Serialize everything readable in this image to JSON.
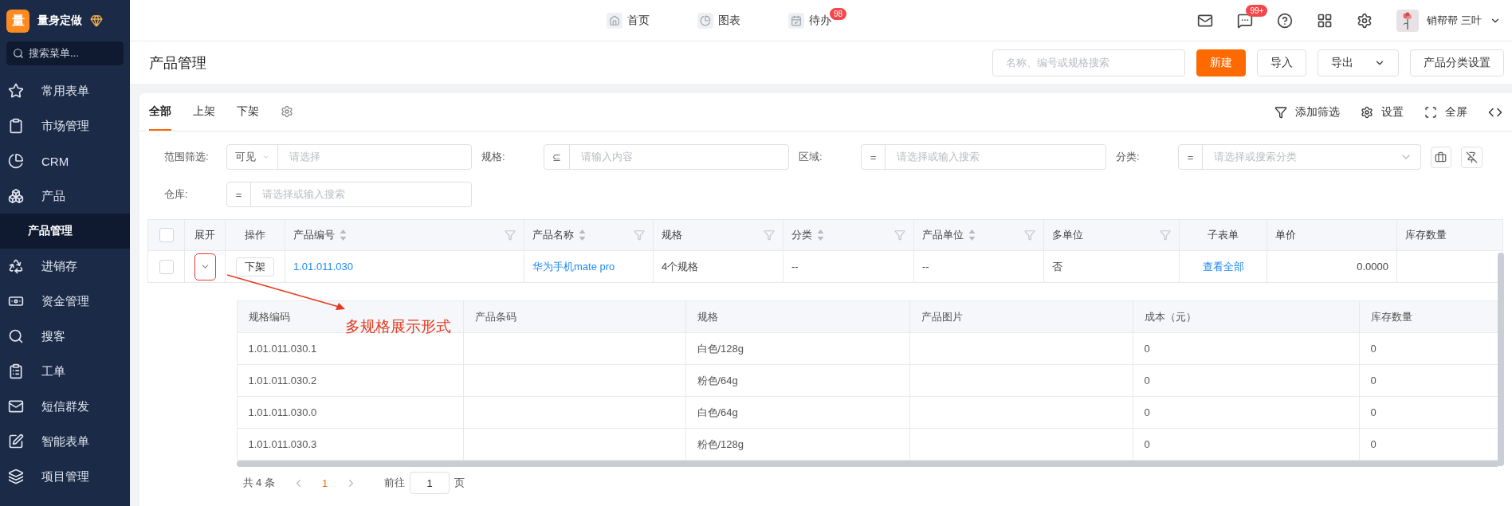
{
  "sidebar": {
    "brand": {
      "logo": "量",
      "name": "量身定做"
    },
    "search": {
      "placeholder": "搜索菜单..."
    },
    "items": [
      {
        "label": "常用表单",
        "selected": false
      },
      {
        "label": "市场管理",
        "selected": false
      },
      {
        "label": "CRM",
        "selected": false
      },
      {
        "label": "产品",
        "selected": false,
        "expanded": true,
        "children": [
          {
            "label": "产品管理",
            "selected": true
          }
        ]
      },
      {
        "label": "进销存",
        "selected": false
      },
      {
        "label": "资金管理",
        "selected": false
      },
      {
        "label": "搜客",
        "selected": false
      },
      {
        "label": "工单",
        "selected": false
      },
      {
        "label": "短信群发",
        "selected": false
      },
      {
        "label": "智能表单",
        "selected": false
      },
      {
        "label": "项目管理",
        "selected": false
      }
    ]
  },
  "topbar": {
    "nav": [
      {
        "label": "首页"
      },
      {
        "label": "图表"
      },
      {
        "label": "待办",
        "badge": "98"
      }
    ],
    "actions": [
      {
        "kind": "mail"
      },
      {
        "kind": "chat",
        "badge": "99+"
      },
      {
        "kind": "help"
      },
      {
        "kind": "apps"
      },
      {
        "kind": "settings"
      }
    ],
    "user": {
      "name": "销帮帮 三叶"
    }
  },
  "page_header": {
    "title": "产品管理",
    "search": {
      "placeholder": "名称、编号或规格搜索"
    },
    "buttons": [
      {
        "label": "新建",
        "kind": "primary"
      },
      {
        "label": "导入",
        "kind": "default"
      },
      {
        "label": "导出",
        "kind": "dropdown"
      },
      {
        "label": "产品分类设置",
        "kind": "default"
      }
    ]
  },
  "tabs": [
    {
      "label": "全部",
      "selected": true
    },
    {
      "label": "上架",
      "selected": false
    },
    {
      "label": "下架",
      "selected": false
    }
  ],
  "tools": [
    {
      "label": "添加筛选",
      "kind": "filter"
    },
    {
      "label": "设置",
      "kind": "settings"
    },
    {
      "label": "全屏",
      "kind": "fullscreen"
    },
    {
      "kind": "code"
    }
  ],
  "filters": [
    {
      "label": "范围筛选:",
      "operator": "可见",
      "kind": "select",
      "placeholder": "请选择"
    },
    {
      "label": "规格:",
      "operator": "⊆",
      "kind": "symbol",
      "placeholder": "请输入内容"
    },
    {
      "label": "区域:",
      "operator": "=",
      "kind": "symbol",
      "placeholder": "请选择或输入搜索"
    },
    {
      "label": "分类:",
      "operator": "=",
      "kind": "symbol",
      "placeholder": "请选择或搜索分类",
      "dropdown": true
    },
    {
      "label": "仓库:",
      "operator": "=",
      "kind": "symbol",
      "placeholder": "请选择或输入搜索"
    }
  ],
  "table": {
    "columns": [
      {
        "kind": "checkbox",
        "checked": false
      },
      {
        "kind": "center",
        "label": "展开"
      },
      {
        "kind": "center",
        "label": "操作"
      },
      {
        "kind": "text",
        "label": "产品编号",
        "sortable": true,
        "filterable": true
      },
      {
        "kind": "text",
        "label": "产品名称",
        "sortable": true,
        "filterable": true
      },
      {
        "kind": "text",
        "label": "规格",
        "sortable": false,
        "filterable": true
      },
      {
        "kind": "text",
        "label": "分类",
        "sortable": true,
        "filterable": true
      },
      {
        "kind": "text",
        "label": "产品单位",
        "sortable": true,
        "filterable": true
      },
      {
        "kind": "text",
        "label": "多单位",
        "sortable": false,
        "filterable": true
      },
      {
        "kind": "center",
        "label": "子表单"
      },
      {
        "kind": "number",
        "label": "单价"
      },
      {
        "kind": "text",
        "label": "库存数量"
      }
    ],
    "rows": [
      {
        "expanded": true,
        "cells": [
          {
            "kind": "checkbox",
            "checked": false
          },
          {
            "kind": "toggle"
          },
          {
            "kind": "button",
            "text": "下架"
          },
          {
            "kind": "link",
            "text": "1.01.011.030"
          },
          {
            "kind": "link",
            "text": "华为手机mate pro"
          },
          {
            "kind": "text",
            "text": "4个规格"
          },
          {
            "kind": "text",
            "text": "--"
          },
          {
            "kind": "text",
            "text": "--"
          },
          {
            "kind": "text",
            "text": "否"
          },
          {
            "kind": "link",
            "text": "查看全部"
          },
          {
            "kind": "text",
            "text": "0.0000"
          },
          {
            "kind": "text",
            "text": ""
          }
        ],
        "detail": {
          "columns": [
            "规格编码",
            "产品条码",
            "规格",
            "产品图片",
            "成本（元）",
            "库存数量"
          ],
          "rows": [
            [
              "1.01.011.030.1",
              "",
              "白色/128g",
              "",
              "0",
              "0"
            ],
            [
              "1.01.011.030.2",
              "",
              "粉色/64g",
              "",
              "0",
              "0"
            ],
            [
              "1.01.011.030.0",
              "",
              "白色/64g",
              "",
              "0",
              "0"
            ],
            [
              "1.01.011.030.3",
              "",
              "粉色/128g",
              "",
              "0",
              "0"
            ]
          ],
          "pagination": {
            "total": "共 4 条",
            "pages": [
              {
                "label": "1",
                "selected": true
              }
            ],
            "goto_label": "前往",
            "goto_value": "1",
            "page_suffix": "页"
          }
        }
      }
    ]
  },
  "annotation": {
    "text": "多规格展示形式"
  }
}
